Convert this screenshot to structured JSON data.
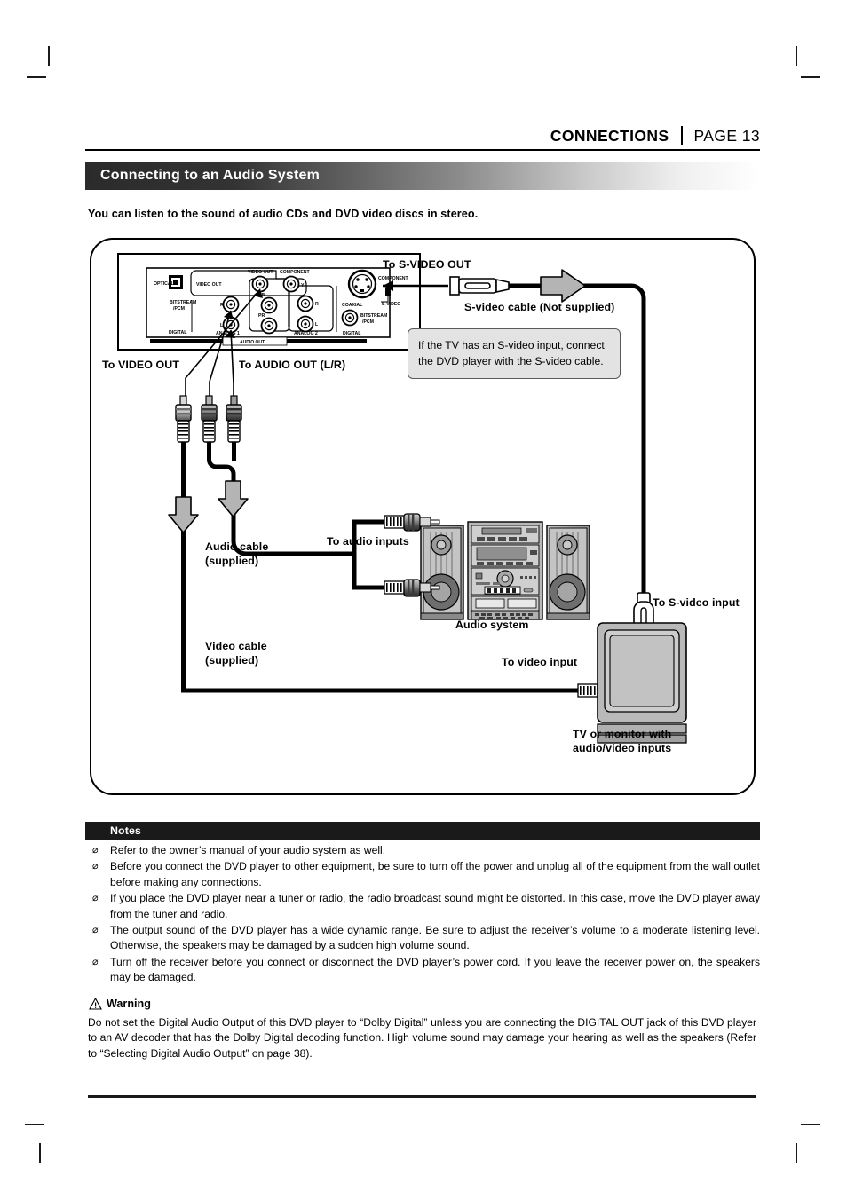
{
  "header": {
    "section": "CONNECTIONS",
    "page_label": "PAGE 13"
  },
  "section_title": "Connecting to an Audio System",
  "intro": "You can listen to the sound of audio CDs and DVD video discs in stereo.",
  "diagram": {
    "rear_panel": {
      "labels": {
        "optical": "OPTICAL",
        "video_out_group": "VIDEO OUT",
        "video_out_jack": "VIDEO OUT",
        "component": "COMPONENT",
        "component_y": "Y",
        "component_pb": "PB",
        "component_pr": "PR",
        "bitstream_pcm_left": "BITSTREAM\n/PCM",
        "digital_left": "DIGITAL",
        "analog1": "ANALOG 1",
        "analog2": "ANALOG 2",
        "analog_r": "R",
        "analog_l": "L",
        "analog2_r": "R",
        "analog2_l": "L",
        "coaxial": "COAXIAL",
        "bitstream_pcm_right": "BITSTREAM\n/PCM",
        "digital_right": "DIGITAL",
        "svideo_component": "COMPONENT",
        "svideo": "S-VIDEO",
        "audio_out": "AUDIO OUT"
      }
    },
    "callouts": {
      "to_svideo_out": "To S-VIDEO OUT",
      "svideo_cable": "S-video cable (Not supplied)",
      "to_video_out": "To VIDEO OUT",
      "to_audio_out": "To AUDIO OUT (L/R)",
      "audio_cable": "Audio cable\n(supplied)",
      "to_audio_inputs": "To audio inputs",
      "audio_system": "Audio system",
      "video_cable": "Video cable\n(supplied)",
      "to_video_input": "To video input",
      "to_svideo_input": "To S-video input",
      "tv_monitor": "TV or monitor with\naudio/video inputs"
    },
    "tip_box": "If the TV has an S-video input, connect the DVD player with the S-video cable."
  },
  "notes": {
    "heading": "Notes",
    "bullet_glyph": "⌀",
    "items": [
      "Refer to the owner’s  manual of your audio system as well.",
      "Before you connect the DVD player to other equipment, be sure to turn off the power and unplug all of the equipment from the wall outlet before making any connections.",
      "If you place the DVD player near a tuner or radio, the radio broadcast sound might be distorted. In this case, move the DVD player away from the tuner and radio.",
      "The output sound of the DVD player has a wide dynamic range. Be sure to adjust the receiver’s volume to a moderate listening level. Otherwise, the speakers may be damaged by a sudden high volume sound.",
      "Turn off the receiver before you connect or disconnect the DVD player’s  power cord. If you leave the receiver power on, the speakers may be damaged."
    ]
  },
  "warning": {
    "heading": "Warning",
    "body": "Do not set the Digital Audio Output of this DVD player to “Dolby Digital” unless you are connecting the DIGITAL OUT jack of this DVD player to an AV decoder that has the Dolby Digital decoding function. High volume sound may damage your hearing as well as the speakers (Refer to “Selecting Digital Audio Output” on page 38)."
  },
  "colors": {
    "bar_dark": "#2b2b2b",
    "callout_bg": "#e3e3e3",
    "cable_black": "#000000",
    "device_gray": "#9a9a9a"
  }
}
